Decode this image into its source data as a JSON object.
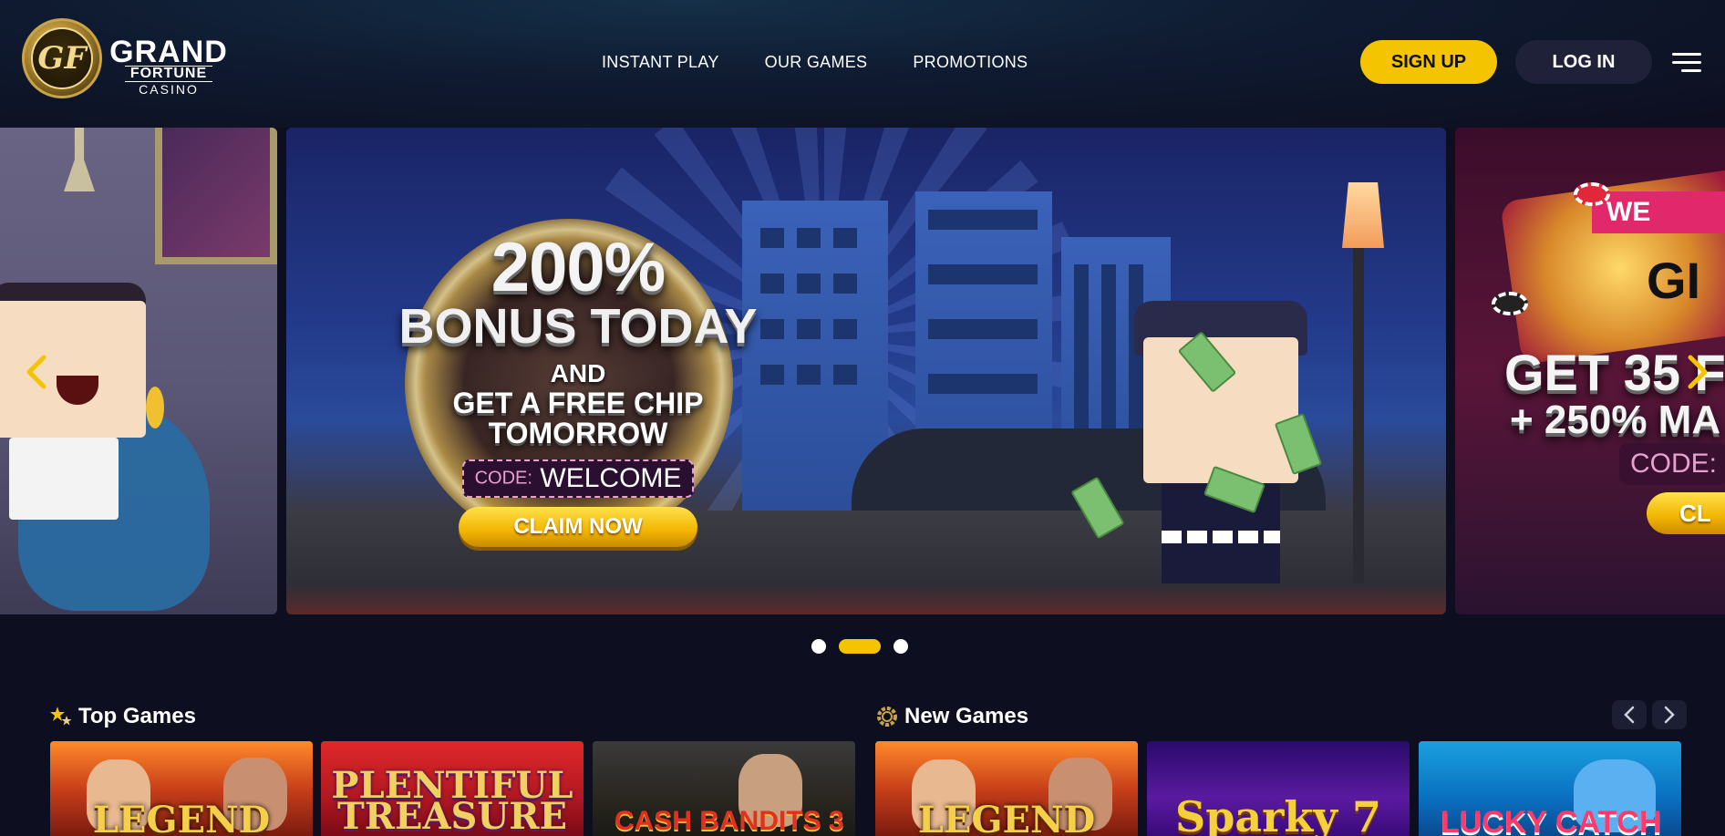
{
  "brand": {
    "monogram": "GF",
    "name_line1": "GRAND",
    "name_line2": "FORTUNE",
    "name_line3": "CASINO",
    "accent_color": "#f5c400",
    "background_color": "#0d0e1f"
  },
  "nav": {
    "items": [
      "INSTANT PLAY",
      "OUR GAMES",
      "PROMOTIONS"
    ]
  },
  "header": {
    "signup_label": "SIGN UP",
    "login_label": "LOG IN",
    "menu_icon": "hamburger-menu-icon"
  },
  "carousel": {
    "active_index": 1,
    "dot_count": 3,
    "prev_icon": "chevron-left-icon",
    "next_icon": "chevron-right-icon",
    "center_slide": {
      "headline_pct": "200%",
      "headline_bonus": "BONUS TODAY",
      "and": "AND",
      "line_chip": "GET A FREE CHIP",
      "line_tomorrow": "TOMORROW",
      "code_label": "CODE:",
      "code_value": "WELCOME",
      "cta_label": "CLAIM NOW"
    },
    "right_slide": {
      "banner": "WE",
      "logo_partial": "GI",
      "headline": "GET 35 F",
      "subline": "+ 250% MA",
      "code_label": "CODE:",
      "cta_label": "CL"
    }
  },
  "sections": {
    "top_games": {
      "title": "Top Games",
      "icon": "stars-icon",
      "games": [
        {
          "title": "LEGEND"
        },
        {
          "title": "PLENTIFUL TREASURE"
        },
        {
          "title": "CASH BANDITS 3"
        }
      ]
    },
    "new_games": {
      "title": "New Games",
      "icon": "gear-badge-icon",
      "prev_icon": "chevron-left-icon",
      "next_icon": "chevron-right-icon",
      "games": [
        {
          "title": "LEGEND"
        },
        {
          "title": "Sparky 7"
        },
        {
          "title": "LUCKY CATCH"
        }
      ]
    }
  }
}
